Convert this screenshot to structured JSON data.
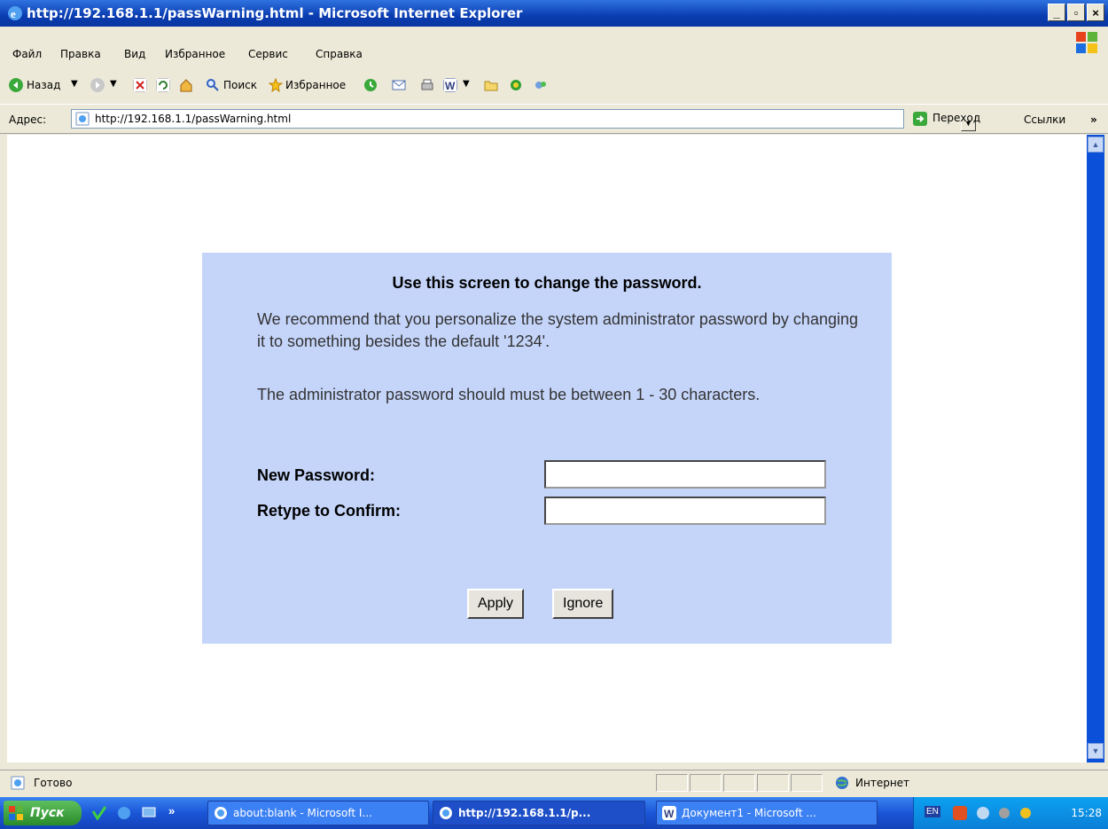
{
  "window": {
    "title": "http://192.168.1.1/passWarning.html - Microsoft Internet Explorer"
  },
  "menu": [
    "Файл",
    "Правка",
    "Вид",
    "Избранное",
    "Сервис",
    "Справка"
  ],
  "toolbar": {
    "back": "Назад",
    "search": "Поиск",
    "favorites": "Избранное"
  },
  "address": {
    "label": "Адрес:",
    "url": "http://192.168.1.1/passWarning.html",
    "go": "Переход",
    "links": "Ссылки"
  },
  "page": {
    "heading": "Use this screen to change the password.",
    "paragraph1": "We recommend that you personalize the system administrator password by changing it to something besides the default '1234'.",
    "paragraph2": "The administrator password should must be between 1 - 30 characters.",
    "new_password_label": "New Password:",
    "confirm_label": "Retype to Confirm:",
    "new_password_value": "",
    "confirm_value": "",
    "apply_label": "Apply",
    "ignore_label": "Ignore"
  },
  "status": {
    "text": "Готово",
    "zone": "Интернет"
  },
  "taskbar": {
    "start": "Пуск",
    "tasks": [
      "about:blank - Microsoft I...",
      "http://192.168.1.1/p...",
      "Документ1 - Microsoft ..."
    ],
    "lang": "EN",
    "clock": "15:28"
  },
  "colors": {
    "panel": "#c5d5fa",
    "titlebar": "#0a3cb0",
    "taskbar": "#1a56d8"
  }
}
